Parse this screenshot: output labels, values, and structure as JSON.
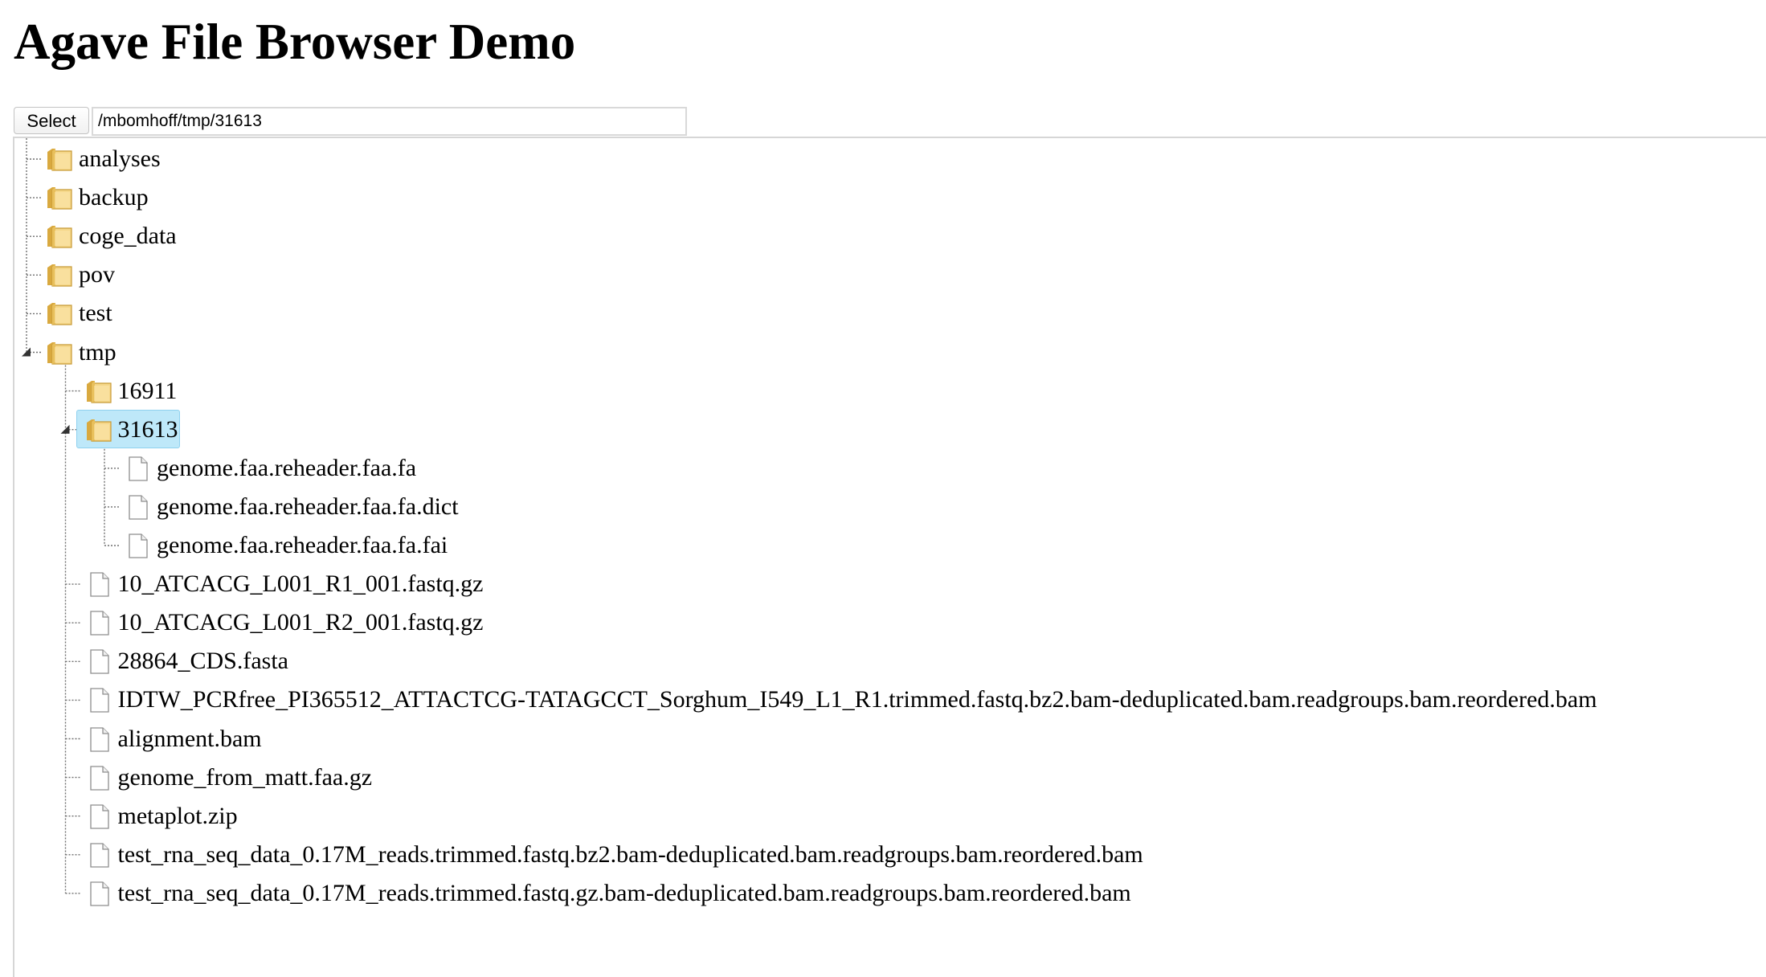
{
  "page": {
    "title": "Agave File Browser Demo"
  },
  "toolbar": {
    "select_label": "Select",
    "path_value": "/mbomhoff/tmp/31613"
  },
  "tree": {
    "root_items": [
      {
        "label": "analyses",
        "type": "folder",
        "icon": "folder-icon"
      },
      {
        "label": "backup",
        "type": "folder",
        "icon": "folder-icon"
      },
      {
        "label": "coge_data",
        "type": "folder",
        "icon": "folder-icon"
      },
      {
        "label": "pov",
        "type": "folder",
        "icon": "folder-icon"
      },
      {
        "label": "test",
        "type": "folder",
        "icon": "folder-icon"
      },
      {
        "label": "tmp",
        "type": "folder",
        "icon": "folder-icon",
        "expanded": true
      }
    ],
    "tmp_items": [
      {
        "label": "16911",
        "type": "folder",
        "icon": "folder-icon"
      },
      {
        "label": "31613",
        "type": "folder",
        "icon": "folder-icon",
        "expanded": true,
        "selected": true
      },
      {
        "label": "10_ATCACG_L001_R1_001.fastq.gz",
        "type": "file",
        "icon": "file-icon"
      },
      {
        "label": "10_ATCACG_L001_R2_001.fastq.gz",
        "type": "file",
        "icon": "file-icon"
      },
      {
        "label": "28864_CDS.fasta",
        "type": "file",
        "icon": "file-icon"
      },
      {
        "label": "IDTW_PCRfree_PI365512_ATTACTCG-TATAGCCT_Sorghum_I549_L1_R1.trimmed.fastq.bz2.bam-deduplicated.bam.readgroups.bam.reordered.bam",
        "type": "file",
        "icon": "file-icon"
      },
      {
        "label": "alignment.bam",
        "type": "file",
        "icon": "file-icon"
      },
      {
        "label": "genome_from_matt.faa.gz",
        "type": "file",
        "icon": "file-icon"
      },
      {
        "label": "metaplot.zip",
        "type": "file",
        "icon": "file-icon"
      },
      {
        "label": "test_rna_seq_data_0.17M_reads.trimmed.fastq.bz2.bam-deduplicated.bam.readgroups.bam.reordered.bam",
        "type": "file",
        "icon": "file-icon"
      },
      {
        "label": "test_rna_seq_data_0.17M_reads.trimmed.fastq.gz.bam-deduplicated.bam.readgroups.bam.reordered.bam",
        "type": "file",
        "icon": "file-icon"
      }
    ],
    "folder_31613_items": [
      {
        "label": "genome.faa.reheader.faa.fa",
        "type": "file",
        "icon": "file-icon"
      },
      {
        "label": "genome.faa.reheader.faa.fa.dict",
        "type": "file",
        "icon": "file-icon"
      },
      {
        "label": "genome.faa.reheader.faa.fa.fai",
        "type": "file",
        "icon": "file-icon"
      }
    ]
  },
  "colors": {
    "selection_bg": "#bee8f9",
    "selection_border": "#8fd1ef",
    "folder_fill": "#f5d78a",
    "folder_dark": "#d9a93f"
  }
}
